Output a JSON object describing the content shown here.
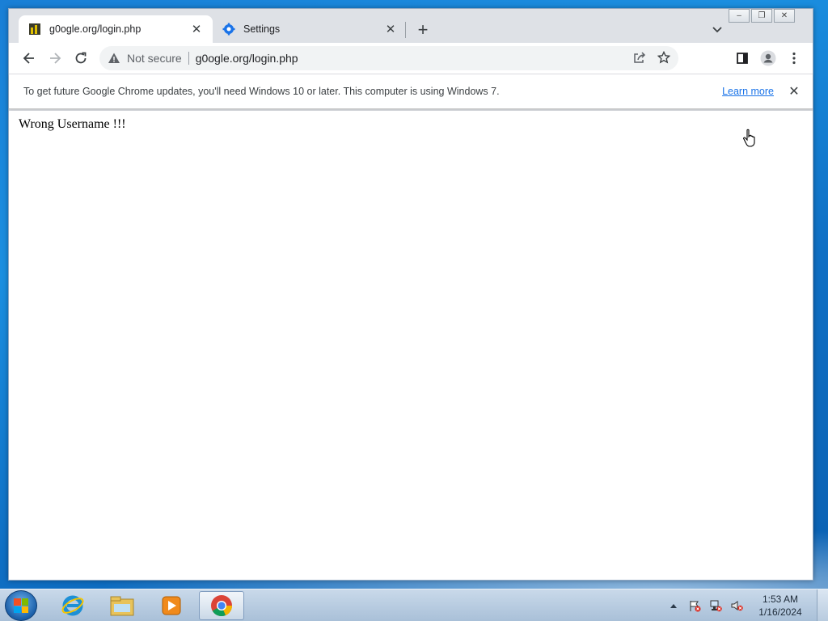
{
  "browser": {
    "tabs": [
      {
        "title": "g0ogle.org/login.php",
        "active": true
      },
      {
        "title": "Settings",
        "active": false
      }
    ],
    "new_tab_symbol": "+",
    "address_bar": {
      "security_label": "Not secure",
      "url": "g0ogle.org/login.php"
    },
    "infobar": {
      "message": "To get future Google Chrome updates, you'll need Windows 10 or later. This computer is using Windows 7.",
      "learn_more": "Learn more"
    }
  },
  "page": {
    "message": "Wrong Username !!!"
  },
  "taskbar": {
    "apps": [
      "internet-explorer",
      "windows-explorer",
      "windows-media-player",
      "google-chrome"
    ],
    "clock": {
      "time": "1:53 AM",
      "date": "1/16/2024"
    }
  },
  "colors": {
    "accent_blue": "#1a73e8",
    "desktop_blue": "#1b8fe0"
  }
}
